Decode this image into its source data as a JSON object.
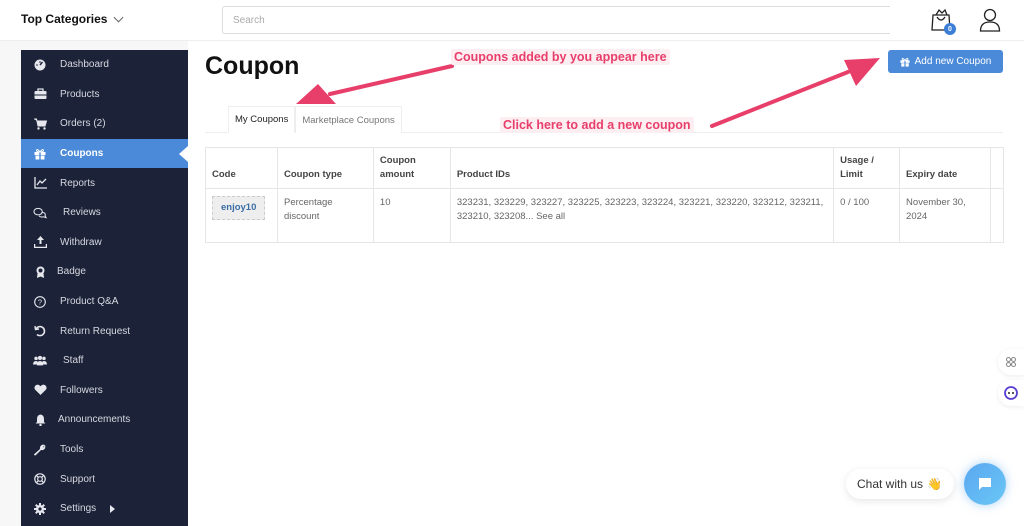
{
  "header": {
    "top_categories_label": "Top Categories",
    "search_placeholder": "Search",
    "cart_count": "0"
  },
  "sidebar": {
    "items": [
      {
        "label": "Dashboard",
        "icon": "dashboard-icon"
      },
      {
        "label": "Products",
        "icon": "briefcase-icon"
      },
      {
        "label": "Orders (2)",
        "icon": "cart-icon"
      },
      {
        "label": "Coupons",
        "icon": "gift-icon",
        "active": true
      },
      {
        "label": "Reports",
        "icon": "chart-line-icon"
      },
      {
        "label": "Reviews",
        "icon": "comments-icon"
      },
      {
        "label": "Withdraw",
        "icon": "upload-icon"
      },
      {
        "label": "Badge",
        "icon": "award-icon"
      },
      {
        "label": "Product Q&A",
        "icon": "question-circle-icon"
      },
      {
        "label": "Return Request",
        "icon": "undo-icon"
      },
      {
        "label": "Staff",
        "icon": "users-icon"
      },
      {
        "label": "Followers",
        "icon": "heart-icon"
      },
      {
        "label": "Announcements",
        "icon": "bell-icon"
      },
      {
        "label": "Tools",
        "icon": "wrench-icon"
      },
      {
        "label": "Support",
        "icon": "life-ring-icon"
      },
      {
        "label": "Settings",
        "icon": "gear-icon",
        "has_submenu": true
      }
    ]
  },
  "main": {
    "title": "Coupon",
    "add_button_label": "Add new Coupon",
    "tabs": [
      {
        "label": "My Coupons",
        "active": true
      },
      {
        "label": "Marketplace Coupons",
        "active": false
      }
    ],
    "table": {
      "columns": [
        "Code",
        "Coupon type",
        "Coupon amount",
        "Product IDs",
        "Usage / Limit",
        "Expiry date",
        ""
      ],
      "rows": [
        {
          "code": "enjoy10",
          "type": "Percentage discount",
          "amount": "10",
          "product_ids": "323231, 323229, 323227, 323225, 323223, 323224, 323221, 323220, 323212, 323211, 323210, 323208...",
          "see_all": "See all",
          "usage": "0 / 100",
          "expiry": "November 30, 2024"
        }
      ]
    }
  },
  "annotations": {
    "coupons_here": "Coupons added by you appear here",
    "click_here": "Click here to add a new coupon",
    "color": "#e83e6a"
  },
  "chat": {
    "label": "Chat with us",
    "emoji": "👋"
  },
  "colors": {
    "accent": "#4a8ad8",
    "sidebar_bg": "#1c2238"
  }
}
